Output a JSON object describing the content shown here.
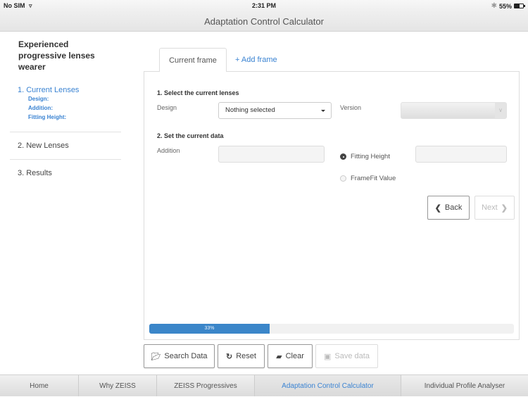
{
  "status_bar": {
    "carrier": "No SIM",
    "time": "2:31 PM",
    "battery_percent": "55%",
    "battery_level": 0.55,
    "icons": [
      "wifi-icon",
      "bluetooth-icon",
      "battery-icon"
    ]
  },
  "nav": {
    "title": "Adaptation Control Calculator"
  },
  "sidebar": {
    "heading": "Experienced progressive lenses wearer",
    "steps": [
      {
        "label": "1. Current Lenses",
        "active": true,
        "details": [
          "Design:",
          "Addition:",
          "Fitting Height:"
        ]
      },
      {
        "label": "2. New Lenses",
        "active": false
      },
      {
        "label": "3. Results",
        "active": false
      }
    ]
  },
  "tabs": {
    "current": "Current frame",
    "add": "+ Add frame"
  },
  "form": {
    "section1_title": "1. Select the current lenses",
    "design_label": "Design",
    "design_value": "Nothing selected",
    "version_label": "Version",
    "version_value": "",
    "section2_title": "2. Set the current data",
    "addition_label": "Addition",
    "addition_value": "",
    "radio_options": [
      {
        "label": "Fitting Height",
        "checked": true
      },
      {
        "label": "FrameFit Value",
        "checked": false
      }
    ],
    "fitting_height_value": ""
  },
  "wizard": {
    "back_label": "Back",
    "next_label": "Next",
    "next_enabled": false
  },
  "progress": {
    "value": 33,
    "label": "33%",
    "color": "#3b86c9"
  },
  "actions": {
    "search": "Search Data",
    "reset": "Reset",
    "clear": "Clear",
    "save": "Save data",
    "save_enabled": false
  },
  "bottom_tabs": [
    {
      "label": "Home",
      "active": false
    },
    {
      "label": "Why ZEISS",
      "active": false
    },
    {
      "label": "ZEISS Progressives",
      "active": false
    },
    {
      "label": "Adaptation Control Calculator",
      "active": true
    },
    {
      "label": "Individual Profile Analyser",
      "active": false
    }
  ],
  "colors": {
    "accent": "#3a83d2"
  }
}
